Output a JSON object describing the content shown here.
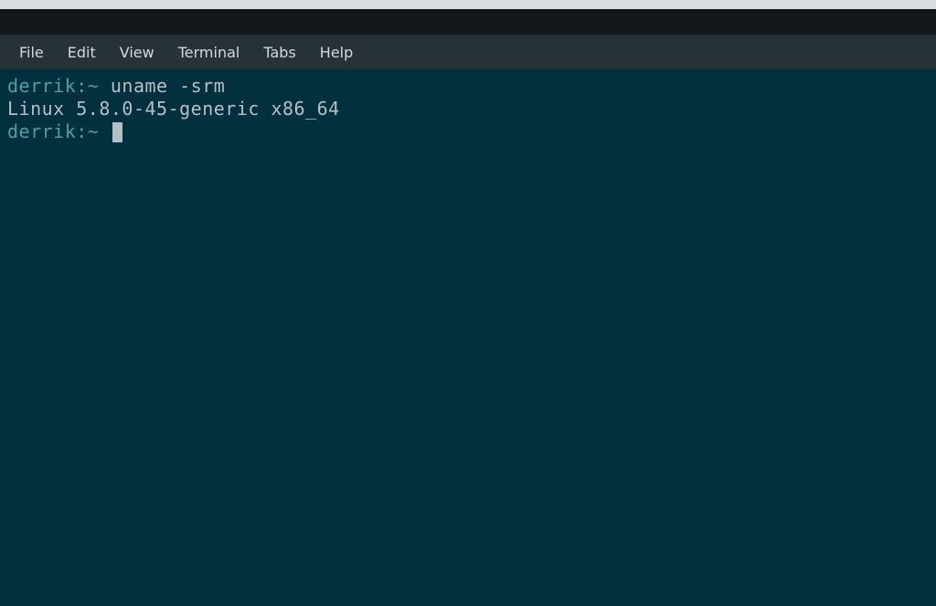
{
  "menubar": {
    "items": [
      {
        "label": "File"
      },
      {
        "label": "Edit"
      },
      {
        "label": "View"
      },
      {
        "label": "Terminal"
      },
      {
        "label": "Tabs"
      },
      {
        "label": "Help"
      }
    ]
  },
  "terminal": {
    "lines": [
      {
        "prompt": "derrik:~ ",
        "command": "uname -srm"
      },
      {
        "output": "Linux 5.8.0-45-generic x86_64"
      },
      {
        "prompt": "derrik:~ ",
        "cursor": true
      }
    ]
  }
}
